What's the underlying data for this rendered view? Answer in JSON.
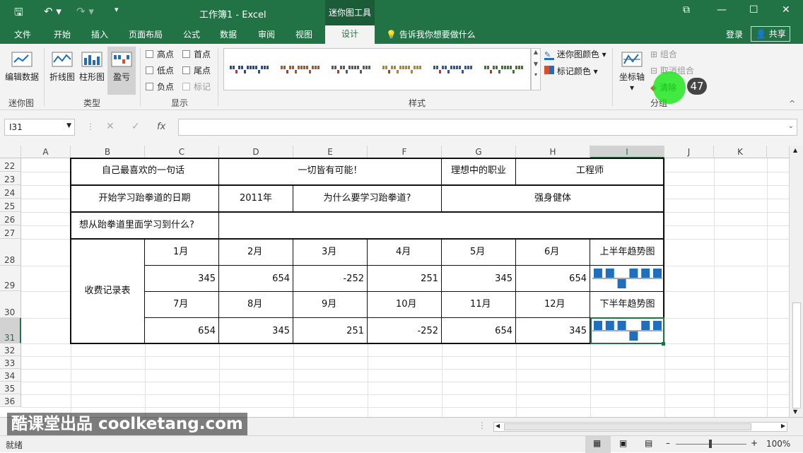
{
  "title_bar": {
    "title": "工作簿1 - Excel",
    "context_tool": "迷你图工具"
  },
  "tabs": {
    "file": "文件",
    "home": "开始",
    "insert": "插入",
    "layout": "页面布局",
    "formulas": "公式",
    "data": "数据",
    "review": "审阅",
    "view": "视图",
    "design": "设计",
    "tell_me": "告诉我你想要做什么",
    "login": "登录",
    "share": "共享"
  },
  "ribbon": {
    "edit_data": "编辑数据",
    "line": "折线图",
    "column": "柱形图",
    "winloss": "盈亏",
    "high": "高点",
    "low": "低点",
    "negative": "负点",
    "first": "首点",
    "last": "尾点",
    "markers": "标记",
    "sparkline_color": "迷你图颜色",
    "marker_color": "标记颜色",
    "axis": "坐标轴",
    "group": "组合",
    "ungroup": "取消组合",
    "clear": "清除",
    "grp_sparkline": "迷你图",
    "grp_type": "类型",
    "grp_show": "显示",
    "grp_style": "样式",
    "grp_group": "分组"
  },
  "formula_bar": {
    "name_box": "I31",
    "fx": "fx",
    "formula": ""
  },
  "columns": [
    "A",
    "B",
    "C",
    "D",
    "E",
    "F",
    "G",
    "H",
    "I",
    "J",
    "K"
  ],
  "rows": [
    "22",
    "23",
    "24",
    "25",
    "26",
    "27",
    "28",
    "29",
    "30",
    "31",
    "32",
    "33",
    "34",
    "35",
    "36"
  ],
  "cells": {
    "fav_label": "自己最喜欢的一句话",
    "fav_value": "一切皆有可能！",
    "job_label": "理想中的职业",
    "job_value": "工程师",
    "start_label": "开始学习跆拳道的日期",
    "start_value": "2011年",
    "why_label": "为什么要学习跆拳道?",
    "why_value": "强身健体",
    "learn_label": "想从跆拳道里面学习到什么?",
    "fee_label": "收费记录表",
    "h1_months": [
      "1月",
      "2月",
      "3月",
      "4月",
      "5月",
      "6月"
    ],
    "h1_values": [
      "345",
      "654",
      "-252",
      "251",
      "345",
      "654"
    ],
    "h2_months": [
      "7月",
      "8月",
      "9月",
      "10月",
      "11月",
      "12月"
    ],
    "h2_values": [
      "654",
      "345",
      "251",
      "-252",
      "654",
      "345"
    ],
    "h1_trend": "上半年趋势图",
    "h2_trend": "下半年趋势图"
  },
  "sparkline_h1": [
    1,
    1,
    -1,
    1,
    1,
    1
  ],
  "sparkline_h2": [
    1,
    1,
    1,
    -1,
    1,
    1
  ],
  "colors": {
    "excel_green": "#217346",
    "sparkline_blue": "#1f6fc0"
  },
  "status": {
    "ready": "就绪",
    "zoom": "100%"
  },
  "watermark": "酷课堂出品 coolketang.com",
  "step_badge": "47"
}
